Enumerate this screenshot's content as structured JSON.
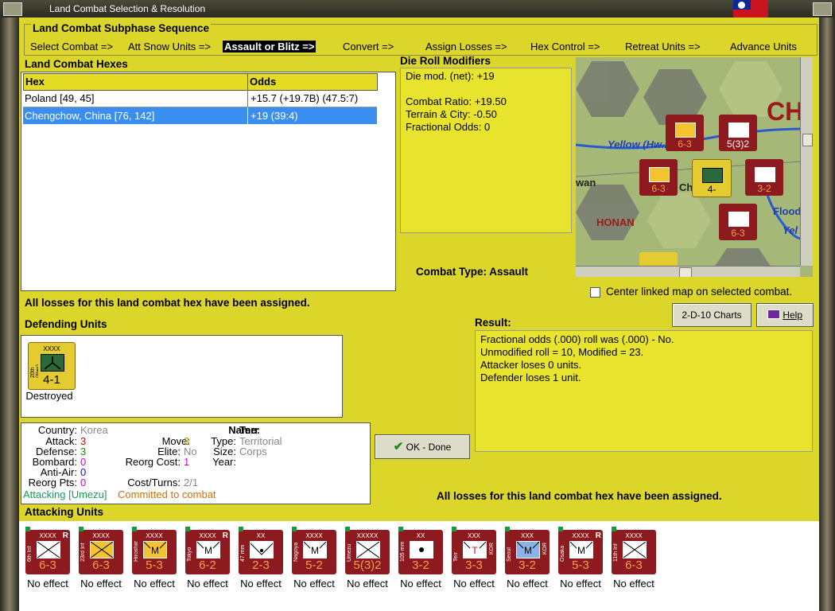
{
  "window": {
    "title": "Land Combat Selection & Resolution"
  },
  "subphase": {
    "heading": "Land Combat Subphase Sequence",
    "steps": [
      "Select Combat =>",
      "Att Snow Units =>",
      "Assault or Blitz =>",
      "Convert =>",
      "Assign Losses =>",
      "Hex Control =>",
      "Retreat Units =>",
      "Advance Units"
    ],
    "active_index": 2
  },
  "hexes": {
    "heading": "Land Combat Hexes",
    "columns": [
      "Hex",
      "Odds"
    ],
    "rows": [
      {
        "hex": "Poland [49, 45]",
        "odds": "+15.7 (+19.7B) (47.5:7)"
      },
      {
        "hex": "Chengchow, China [76, 142]",
        "odds": "+19 (39:4)",
        "selected": true
      }
    ]
  },
  "modifiers": {
    "heading": "Die Roll Modifiers",
    "lines": [
      "Die mod. (net): +19",
      "",
      "Combat Ratio: +19.50",
      "Terrain & City: -0.50",
      "Fractional Odds: 0"
    ]
  },
  "map": {
    "labels": {
      "river": "Yellow (Hw...",
      "province": "HONAN",
      "flood": "Flood",
      "yel": "Yel",
      "city": "CH",
      "cityname": "Ch",
      "wan": "wan"
    },
    "center_checkbox": "Center linked map on selected combat.",
    "center_checked": false
  },
  "combat_type": {
    "label": "Combat Type:",
    "value": "Assault"
  },
  "losses_msg": "All losses for this land combat hex have been assigned.",
  "defending": {
    "heading": "Defending Units",
    "units": [
      {
        "name": "20th (Res)",
        "size": "XXXX",
        "strength": "4-1",
        "status": "Destroyed"
      }
    ]
  },
  "info": {
    "country_l": "Country:",
    "country": "Korea",
    "attack_l": "Attack:",
    "attack": "3",
    "defense_l": "Defense:",
    "defense": "3",
    "bombard_l": "Bombard:",
    "bombard": "0",
    "antiair_l": "Anti-Air:",
    "antiair": "0",
    "reorg_l": "Reorg Pts:",
    "reorg": "0",
    "move_l": "Move:",
    "move": "3",
    "elite_l": "Elite:",
    "elite": "No",
    "reorgcost_l": "Reorg Cost:",
    "reorgcost": "1",
    "costturns_l": "Cost/Turns:",
    "costturns": "2/1",
    "name_l": "Name:",
    "name": "Terr",
    "type_l": "Type:",
    "type": "Territorial",
    "size_l": "Size:",
    "size": "Corps",
    "year_l": "Year:",
    "year": "",
    "attacking": "Attacking [Umezu]",
    "committed": "Committed to combat"
  },
  "buttons": {
    "charts": "2-D-10 Charts",
    "help": "Help",
    "done": "OK - Done"
  },
  "result": {
    "heading": "Result:",
    "lines": [
      "Fractional odds (.000) roll was (.000)  - No.",
      "Unmodified roll = 10, Modified = 23.",
      "Attacker loses 0 units.",
      "Defender loses 1 unit."
    ]
  },
  "bottom_msg": "All losses for this land combat hex have been assigned.",
  "attacking": {
    "heading": "Attacking Units",
    "units": [
      {
        "name": "6th Inf",
        "size": "XXXX",
        "strength": "6-3",
        "status": "No effect",
        "symbol": "inf",
        "reserve": true
      },
      {
        "name": "23rd Inf",
        "size": "XXXX",
        "strength": "6-3",
        "status": "No effect",
        "symbol": "inf-y"
      },
      {
        "name": "Hiroshima",
        "size": "XXXX",
        "strength": "5-3",
        "status": "No effect",
        "symbol": "mtn-y"
      },
      {
        "name": "Tokyo",
        "size": "XXXX",
        "strength": "6-2",
        "status": "No effect",
        "symbol": "mtn",
        "reserve": true
      },
      {
        "name": "47 mm",
        "size": "XX",
        "strength": "2-3",
        "status": "No effect",
        "symbol": "at"
      },
      {
        "name": "Nagoya",
        "size": "XXXX",
        "strength": "5-2",
        "status": "No effect",
        "symbol": "mtn"
      },
      {
        "name": "Umezu",
        "size": "XXXXX",
        "strength": "5(3)2",
        "status": "No effect",
        "symbol": "inf"
      },
      {
        "name": "105 mm",
        "size": "XX",
        "strength": "3-2",
        "status": "No effect",
        "symbol": "art"
      },
      {
        "name": "Terr",
        "size": "XXX",
        "strength": "3-3",
        "status": "No effect",
        "symbol": "terr",
        "kor": true
      },
      {
        "name": "Seoul",
        "size": "XXX",
        "strength": "3-2",
        "status": "No effect",
        "symbol": "mtn-b",
        "kor": true
      },
      {
        "name": "Osaka",
        "size": "XXXX",
        "strength": "5-3",
        "status": "No effect",
        "symbol": "mtn",
        "reserve": true
      },
      {
        "name": "11th Inf",
        "size": "XXXX",
        "strength": "6-3",
        "status": "No effect",
        "symbol": "inf"
      }
    ]
  }
}
